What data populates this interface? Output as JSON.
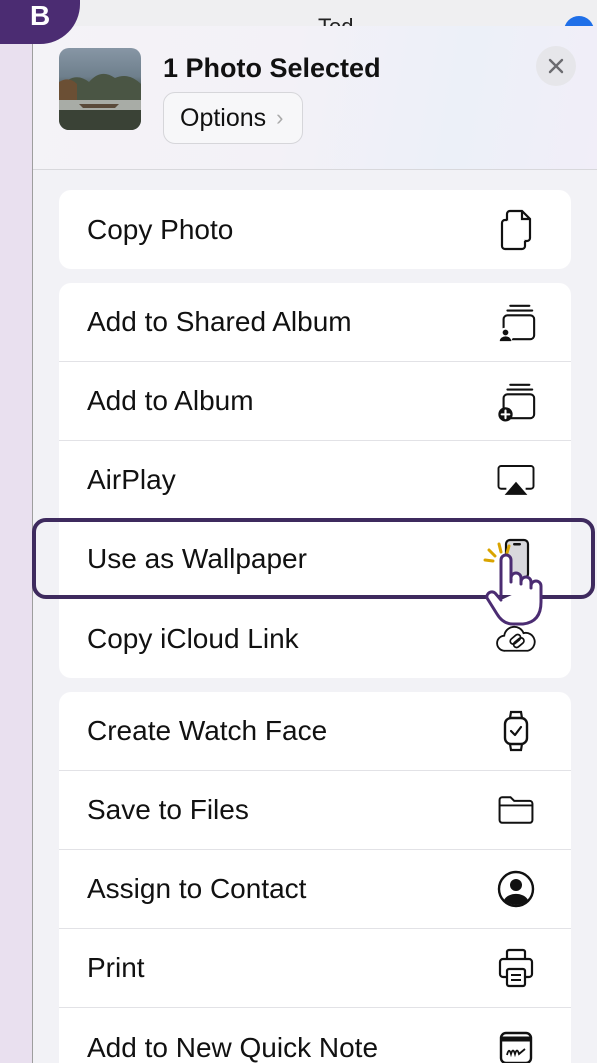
{
  "step_badge": "B",
  "background_peek": {
    "title": "Tod"
  },
  "header": {
    "title": "1 Photo Selected",
    "options_label": "Options",
    "options_chevron": "›",
    "close_icon": "close-icon"
  },
  "groups": [
    {
      "items": [
        {
          "label": "Copy Photo",
          "icon": "copy-icon"
        }
      ]
    },
    {
      "items": [
        {
          "label": "Add to Shared Album",
          "icon": "shared-album-icon"
        },
        {
          "label": "Add to Album",
          "icon": "add-album-icon"
        },
        {
          "label": "AirPlay",
          "icon": "airplay-icon"
        },
        {
          "label": "Use as Wallpaper",
          "icon": "wallpaper-icon",
          "highlighted": true
        },
        {
          "label": "Copy iCloud Link",
          "icon": "icloud-link-icon"
        }
      ]
    },
    {
      "items": [
        {
          "label": "Create Watch Face",
          "icon": "watch-icon"
        },
        {
          "label": "Save to Files",
          "icon": "folder-icon"
        },
        {
          "label": "Assign to Contact",
          "icon": "contact-icon"
        },
        {
          "label": "Print",
          "icon": "printer-icon"
        },
        {
          "label": "Add to New Quick Note",
          "icon": "quick-note-icon"
        }
      ]
    }
  ],
  "colors": {
    "accent": "#4b2c72",
    "highlight_border": "#3e2a5e",
    "sheet_bg": "#f2f2f6"
  }
}
